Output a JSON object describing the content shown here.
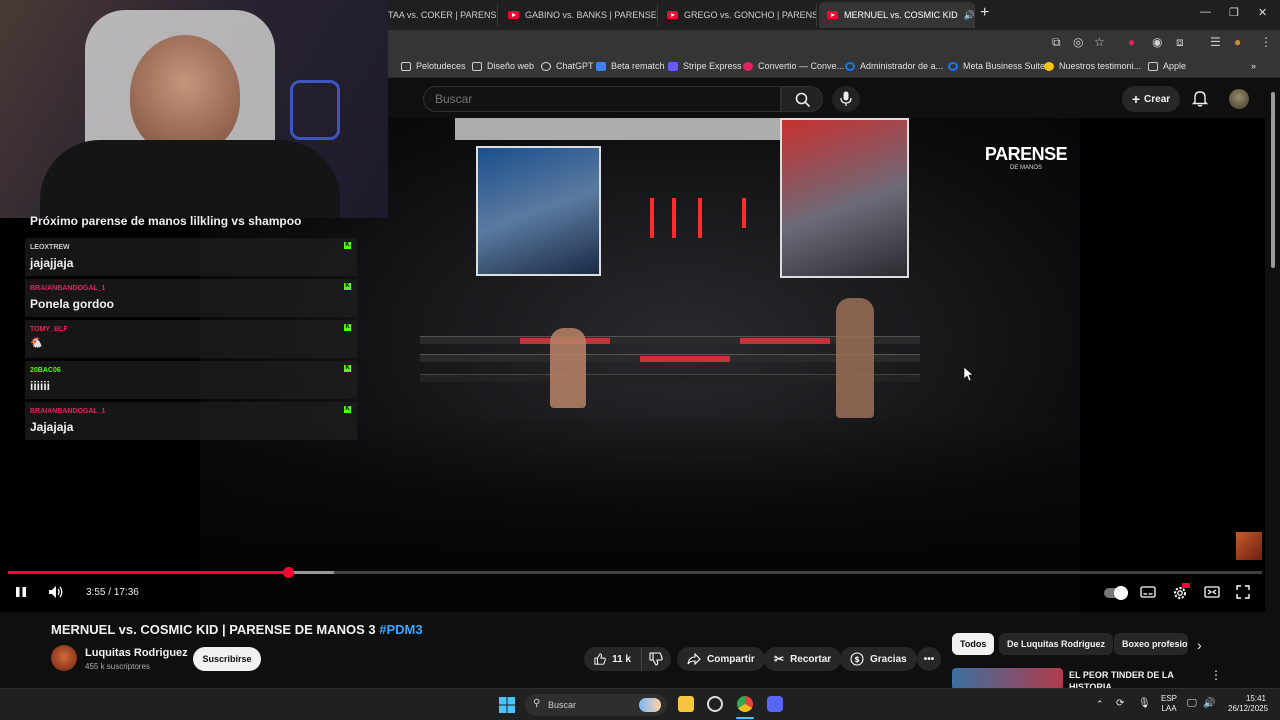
{
  "browser": {
    "tabs": [
      {
        "label": "TAA vs. COKER | PARENSE",
        "active": false
      },
      {
        "label": "GABINO vs. BANKS | PARENSE D",
        "active": false
      },
      {
        "label": "GREGO vs. GONCHO | PARENSE",
        "active": false
      },
      {
        "label": "MERNUEL vs. COSMIC KID",
        "active": true
      }
    ],
    "bookmarks": [
      {
        "label": "Pelotudeces",
        "icon": "folder-icon"
      },
      {
        "label": "Diseño web",
        "icon": "folder-icon"
      },
      {
        "label": "ChatGPT",
        "icon": "chatgpt-icon"
      },
      {
        "label": "Beta rematch",
        "icon": "doc-icon"
      },
      {
        "label": "Stripe Express",
        "icon": "stripe-icon"
      },
      {
        "label": "Convertio — Conve...",
        "icon": "convertio-icon"
      },
      {
        "label": "Administrador de a...",
        "icon": "meta-icon"
      },
      {
        "label": "Meta Business Suite",
        "icon": "meta-icon"
      },
      {
        "label": "Nuestros testimoni...",
        "icon": "star-icon"
      },
      {
        "label": "Apple",
        "icon": "folder-icon"
      }
    ]
  },
  "header": {
    "search_placeholder": "Buscar",
    "create_label": "Crear"
  },
  "overlay": {
    "chat": [
      {
        "user": "",
        "text": "Próximo parense de manos lilkling vs shampoo",
        "user_color": "#ffffff"
      },
      {
        "user": "LEOXTREW",
        "text": "jajajjaja",
        "user_color": "#c8c8c8"
      },
      {
        "user": "BRAIANBANDOGAL_1",
        "text": "Ponela gordoo",
        "user_color": "#e0245e"
      },
      {
        "user": "TOMY_BLF",
        "text": "🐔",
        "user_color": "#e0245e"
      },
      {
        "user": "20BAC06",
        "text": "iiiiii",
        "user_color": "#53fc18"
      },
      {
        "user": "BRAIANBANDOGAL_1",
        "text": "Jajajaja",
        "user_color": "#e0245e"
      }
    ],
    "watermark": "PARENSE",
    "watermark_sub": "DE MANOS"
  },
  "player": {
    "current_time": "3:55",
    "separator": " / ",
    "duration": "17:36",
    "played_fraction": 0.223,
    "buffered_fraction": 0.26
  },
  "video_info": {
    "title": "MERNUEL vs. COSMIC KID | PARENSE DE MANOS 3",
    "hashtag": "#PDM3",
    "channel_name": "Luquitas Rodriguez",
    "subscribers": "455 k suscriptores",
    "subscribe_label": "Suscribirse",
    "like_count": "11 k",
    "share_label": "Compartir",
    "clip_label": "Recortar",
    "thanks_label": "Gracias"
  },
  "recommendations": {
    "chips": [
      "Todos",
      "De Luquitas Rodriguez",
      "Boxeo profesio"
    ],
    "first_title": "EL PEOR TINDER DE LA HISTORIA"
  },
  "taskbar": {
    "search_label": "Buscar",
    "lang_top": "ESP",
    "lang_bottom": "LAA",
    "time": "15:41",
    "date": "26/12/2025"
  }
}
